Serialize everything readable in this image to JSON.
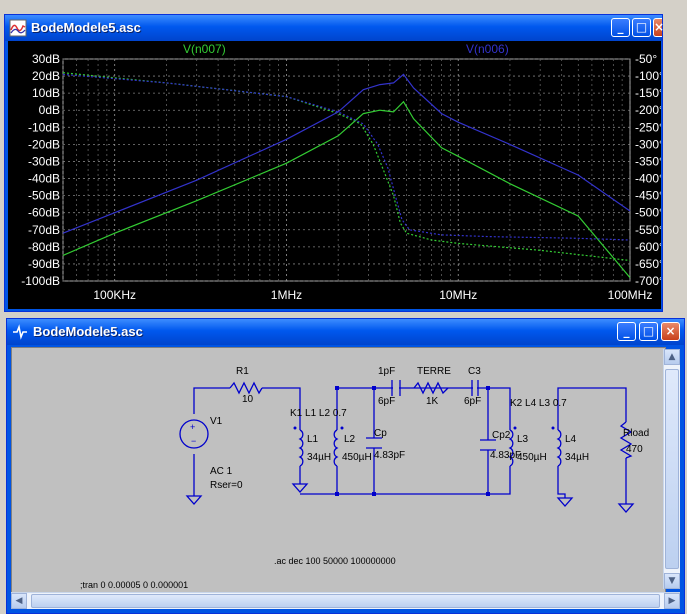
{
  "plot_window": {
    "title": "BodeModele5.asc",
    "trace1_name": "V(n007)",
    "trace2_name": "V(n006)",
    "trace1_color": "#33cc33",
    "trace2_color": "#3333cc",
    "icon": "waveform-icon",
    "buttons": {
      "minimize": "_",
      "maximize": "□",
      "close": "×"
    }
  },
  "chart_data": {
    "type": "line",
    "x_scale": "log",
    "xlim": [
      50000,
      100000000
    ],
    "x_ticks": [
      "100KHz",
      "1MHz",
      "10MHz",
      "100MHz"
    ],
    "y_left_ticks": [
      "30dB",
      "20dB",
      "10dB",
      "0dB",
      "-10dB",
      "-20dB",
      "-30dB",
      "-40dB",
      "-50dB",
      "-60dB",
      "-70dB",
      "-80dB",
      "-90dB",
      "-100dB"
    ],
    "y_left_lim": [
      -100,
      30
    ],
    "y_right_ticks": [
      "-50°",
      "-100°",
      "-150°",
      "-200°",
      "-250°",
      "-300°",
      "-350°",
      "-400°",
      "-450°",
      "-500°",
      "-550°",
      "-600°",
      "-650°",
      "-700°"
    ],
    "y_right_lim": [
      -700,
      -50
    ],
    "grid": true,
    "series": [
      {
        "name": "V(n007)",
        "color": "#33cc33",
        "magnitude": {
          "x": [
            50000,
            100000,
            300000,
            1000000,
            2000000,
            2800000,
            3500000,
            4200000,
            4800000,
            5500000,
            8000000,
            10000000,
            20000000,
            50000000,
            100000000
          ],
          "y": [
            -85,
            -72,
            -53,
            -31,
            -15,
            -2,
            0,
            -1,
            5,
            -5,
            -22,
            -27,
            -43,
            -62,
            -98
          ]
        },
        "phase": {
          "x": [
            50000,
            200000,
            1000000,
            2000000,
            2700000,
            3200000,
            3700000,
            4200000,
            4600000,
            5000000,
            7000000,
            10000000,
            30000000,
            100000000
          ],
          "y": [
            -90,
            -120,
            -160,
            -210,
            -240,
            -300,
            -380,
            -450,
            -530,
            -560,
            -580,
            -590,
            -610,
            -640
          ]
        }
      },
      {
        "name": "V(n006)",
        "color": "#3333cc",
        "magnitude": {
          "x": [
            50000,
            100000,
            300000,
            1000000,
            2000000,
            2800000,
            3500000,
            4200000,
            4800000,
            5500000,
            8000000,
            10000000,
            20000000,
            50000000,
            100000000
          ],
          "y": [
            -72,
            -60,
            -41,
            -17,
            -1,
            12,
            15,
            16,
            21,
            13,
            -2,
            -7,
            -20,
            -38,
            -59
          ]
        },
        "phase": {
          "x": [
            50000,
            200000,
            1000000,
            2000000,
            2800000,
            3400000,
            3900000,
            4300000,
            4700000,
            5200000,
            8000000,
            15000000,
            50000000,
            100000000
          ],
          "y": [
            -95,
            -120,
            -160,
            -205,
            -240,
            -300,
            -370,
            -450,
            -520,
            -550,
            -565,
            -570,
            -575,
            -580
          ]
        }
      }
    ]
  },
  "schematic_window": {
    "title": "BodeModele5.asc",
    "icon": "schematic-icon",
    "buttons": {
      "minimize": "_",
      "maximize": "□",
      "close": "×"
    },
    "labels": {
      "r1": "R1",
      "r1_val": "10",
      "v1": "V1",
      "v1_spec1": "AC 1",
      "v1_spec2": "Rser=0",
      "k1": "K1 L1 L2 0.7",
      "l1": "L1",
      "l1_val": "34µH",
      "l2": "L2",
      "l2_val": "450µH",
      "c1pf": "1pF",
      "c6pf": "6pF",
      "cp": "Cp",
      "cp_val": "4.83pF",
      "terre": "TERRE",
      "terre_val": "1K",
      "c3": "C3",
      "c3_val": "6pF",
      "k2": "K2 L4 L3 0.7",
      "cp2": "Cp2",
      "cp2_val": "4.83pF",
      "l3": "L3",
      "l3_val": "450µH",
      "l4": "L4",
      "l4_val": "34µH",
      "rload": "Rload",
      "rload_val": "470",
      "ac_cmd": ".ac dec 100 50000 100000000",
      "tran_cmd": ";tran 0 0.00005 0 0.000001"
    }
  }
}
